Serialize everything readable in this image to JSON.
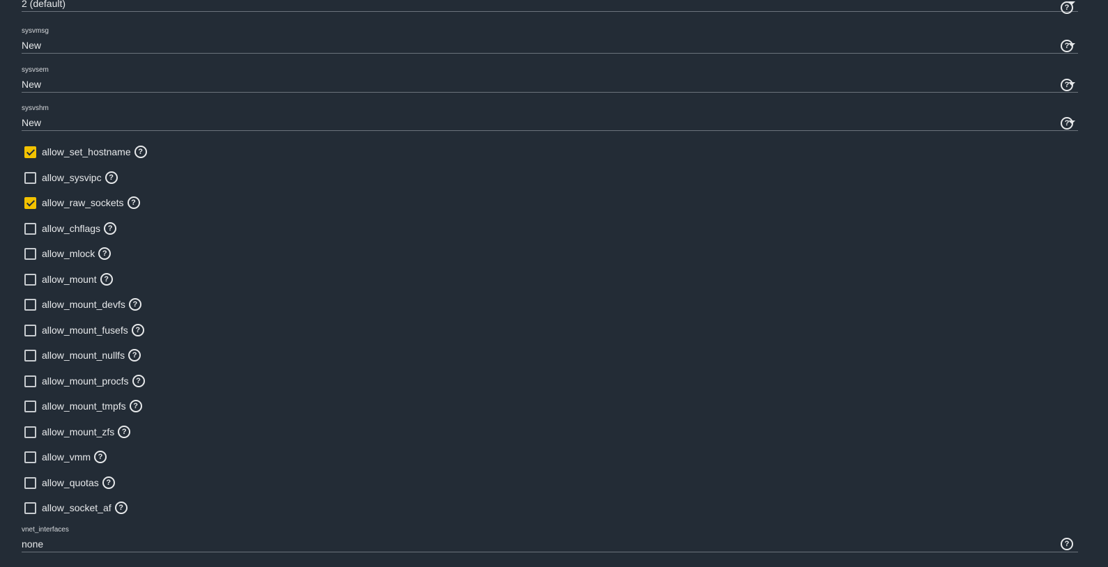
{
  "fields": {
    "devfs_ruleset": {
      "value": "2 (default)"
    },
    "sysvmsg": {
      "label": "sysvmsg",
      "value": "New"
    },
    "sysvsem": {
      "label": "sysvsem",
      "value": "New"
    },
    "sysvshm": {
      "label": "sysvshm",
      "value": "New"
    },
    "vnet_interfaces": {
      "label": "vnet_interfaces",
      "value": "none"
    }
  },
  "checkboxes": [
    {
      "label": "allow_set_hostname",
      "checked": true
    },
    {
      "label": "allow_sysvipc",
      "checked": false
    },
    {
      "label": "allow_raw_sockets",
      "checked": true
    },
    {
      "label": "allow_chflags",
      "checked": false
    },
    {
      "label": "allow_mlock",
      "checked": false
    },
    {
      "label": "allow_mount",
      "checked": false
    },
    {
      "label": "allow_mount_devfs",
      "checked": false
    },
    {
      "label": "allow_mount_fusefs",
      "checked": false
    },
    {
      "label": "allow_mount_nullfs",
      "checked": false
    },
    {
      "label": "allow_mount_procfs",
      "checked": false
    },
    {
      "label": "allow_mount_tmpfs",
      "checked": false
    },
    {
      "label": "allow_mount_zfs",
      "checked": false
    },
    {
      "label": "allow_vmm",
      "checked": false
    },
    {
      "label": "allow_quotas",
      "checked": false
    },
    {
      "label": "allow_socket_af",
      "checked": false
    }
  ],
  "icons": {
    "help": "question-circle-icon",
    "dropdown": "caret-down-icon"
  },
  "colors": {
    "background": "#232c36",
    "accent_checked": "#f2c200",
    "text": "#e6e8ea"
  }
}
